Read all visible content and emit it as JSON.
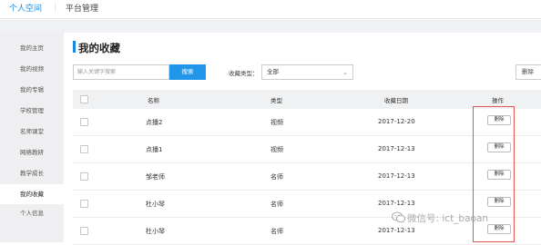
{
  "topnav": {
    "tabs": [
      {
        "label": "个人空间"
      },
      {
        "label": "平台管理"
      }
    ]
  },
  "sidebar": {
    "items": [
      {
        "label": "我的主页"
      },
      {
        "label": "我的视频"
      },
      {
        "label": "我的专辑"
      },
      {
        "label": "学校管理"
      },
      {
        "label": "名师课堂"
      },
      {
        "label": "网络教研"
      },
      {
        "label": "教学成长"
      },
      {
        "label": "我的收藏"
      },
      {
        "label": "个人信息"
      }
    ]
  },
  "page": {
    "title": "我的收藏"
  },
  "search": {
    "placeholder": "输入关键字搜索",
    "button": "搜索"
  },
  "filter": {
    "label": "收藏类型：",
    "selected": "全部"
  },
  "toolbar": {
    "delete_label": "删除"
  },
  "table": {
    "headers": {
      "name": "名称",
      "type": "类型",
      "date": "收藏日期",
      "action": "操作"
    },
    "rows": [
      {
        "name": "点播2",
        "type": "视频",
        "date": "2017-12-20",
        "action": "删除"
      },
      {
        "name": "点播1",
        "type": "视频",
        "date": "2017-12-13",
        "action": "删除"
      },
      {
        "name": "邹老师",
        "type": "名师",
        "date": "2017-12-13",
        "action": "删除"
      },
      {
        "name": "杜小琴",
        "type": "名师",
        "date": "2017-12-13",
        "action": "删除"
      },
      {
        "name": "杜小琴",
        "type": "名师",
        "date": "2017-12-13",
        "action": "删除"
      }
    ]
  },
  "watermark": {
    "text": "微信号: ict_baoan"
  },
  "colors": {
    "accent": "#1a8ae0",
    "button": "#2196e8",
    "highlight_box": "#e25555"
  }
}
